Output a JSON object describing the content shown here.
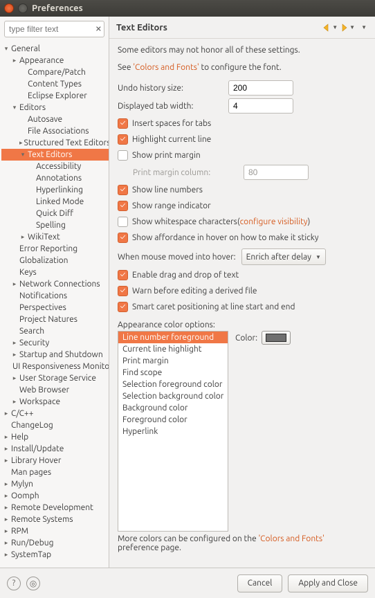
{
  "window": {
    "title": "Preferences"
  },
  "filter": {
    "placeholder": "type filter text"
  },
  "tree": [
    {
      "d": 0,
      "a": "▾",
      "l": "General"
    },
    {
      "d": 1,
      "a": "▸",
      "l": "Appearance"
    },
    {
      "d": 2,
      "a": "",
      "l": "Compare/Patch"
    },
    {
      "d": 2,
      "a": "",
      "l": "Content Types"
    },
    {
      "d": 2,
      "a": "",
      "l": "Eclipse Explorer"
    },
    {
      "d": 1,
      "a": "▾",
      "l": "Editors"
    },
    {
      "d": 2,
      "a": "",
      "l": "Autosave"
    },
    {
      "d": 2,
      "a": "",
      "l": "File Associations"
    },
    {
      "d": 2,
      "a": "▸",
      "l": "Structured Text Editors"
    },
    {
      "d": 2,
      "a": "▾",
      "l": "Text Editors",
      "sel": true
    },
    {
      "d": 3,
      "a": "",
      "l": "Accessibility"
    },
    {
      "d": 3,
      "a": "",
      "l": "Annotations"
    },
    {
      "d": 3,
      "a": "",
      "l": "Hyperlinking"
    },
    {
      "d": 3,
      "a": "",
      "l": "Linked Mode"
    },
    {
      "d": 3,
      "a": "",
      "l": "Quick Diff"
    },
    {
      "d": 3,
      "a": "",
      "l": "Spelling"
    },
    {
      "d": 2,
      "a": "▸",
      "l": "WikiText"
    },
    {
      "d": 1,
      "a": "",
      "l": "Error Reporting"
    },
    {
      "d": 1,
      "a": "",
      "l": "Globalization"
    },
    {
      "d": 1,
      "a": "",
      "l": "Keys"
    },
    {
      "d": 1,
      "a": "▸",
      "l": "Network Connections"
    },
    {
      "d": 1,
      "a": "",
      "l": "Notifications"
    },
    {
      "d": 1,
      "a": "",
      "l": "Perspectives"
    },
    {
      "d": 1,
      "a": "",
      "l": "Project Natures"
    },
    {
      "d": 1,
      "a": "",
      "l": "Search"
    },
    {
      "d": 1,
      "a": "▸",
      "l": "Security"
    },
    {
      "d": 1,
      "a": "▸",
      "l": "Startup and Shutdown"
    },
    {
      "d": 1,
      "a": "",
      "l": "UI Responsiveness Monitoring"
    },
    {
      "d": 1,
      "a": "▸",
      "l": "User Storage Service"
    },
    {
      "d": 1,
      "a": "",
      "l": "Web Browser"
    },
    {
      "d": 1,
      "a": "▸",
      "l": "Workspace"
    },
    {
      "d": 0,
      "a": "▸",
      "l": "C/C++"
    },
    {
      "d": 0,
      "a": "",
      "l": "ChangeLog"
    },
    {
      "d": 0,
      "a": "▸",
      "l": "Help"
    },
    {
      "d": 0,
      "a": "▸",
      "l": "Install/Update"
    },
    {
      "d": 0,
      "a": "▸",
      "l": "Library Hover"
    },
    {
      "d": 0,
      "a": "",
      "l": "Man pages"
    },
    {
      "d": 0,
      "a": "▸",
      "l": "Mylyn"
    },
    {
      "d": 0,
      "a": "▸",
      "l": "Oomph"
    },
    {
      "d": 0,
      "a": "▸",
      "l": "Remote Development"
    },
    {
      "d": 0,
      "a": "▸",
      "l": "Remote Systems"
    },
    {
      "d": 0,
      "a": "▸",
      "l": "RPM"
    },
    {
      "d": 0,
      "a": "▸",
      "l": "Run/Debug"
    },
    {
      "d": 0,
      "a": "▸",
      "l": "SystemTap"
    }
  ],
  "page": {
    "title": "Text Editors",
    "note1": "Some editors may not honor all of these settings.",
    "note2_pre": "See ",
    "note2_link": "'Colors and Fonts'",
    "note2_post": " to configure the font.",
    "undo_label": "Undo history size:",
    "undo_value": "200",
    "tab_label": "Displayed tab width:",
    "tab_value": "4",
    "chk_insert_spaces": "Insert spaces for tabs",
    "chk_highlight_line": "Highlight current line",
    "chk_print_margin": "Show print margin",
    "margin_col_label": "Print margin column:",
    "margin_col_value": "80",
    "chk_line_numbers": "Show line numbers",
    "chk_range": "Show range indicator",
    "chk_whitespace_pre": "Show whitespace characters(",
    "chk_whitespace_link": "configure visibility",
    "chk_whitespace_post": ")",
    "chk_affordance": "Show affordance in hover on how to make it sticky",
    "hover_label": "When mouse moved into hover:",
    "hover_value": "Enrich after delay",
    "chk_dnd": "Enable drag and drop of text",
    "chk_warn_derived": "Warn before editing a derived file",
    "chk_smart_caret": "Smart caret positioning at line start and end",
    "color_section": "Appearance color options:",
    "color_options": [
      "Line number foreground",
      "Current line highlight",
      "Print margin",
      "Find scope",
      "Selection foreground color",
      "Selection background color",
      "Background color",
      "Foreground color",
      "Hyperlink"
    ],
    "color_label": "Color:",
    "footnote_pre": "More colors can be configured on the ",
    "footnote_link": "'Colors and Fonts'",
    "footnote_post": " preference page."
  },
  "buttons": {
    "cancel": "Cancel",
    "apply": "Apply and Close"
  }
}
